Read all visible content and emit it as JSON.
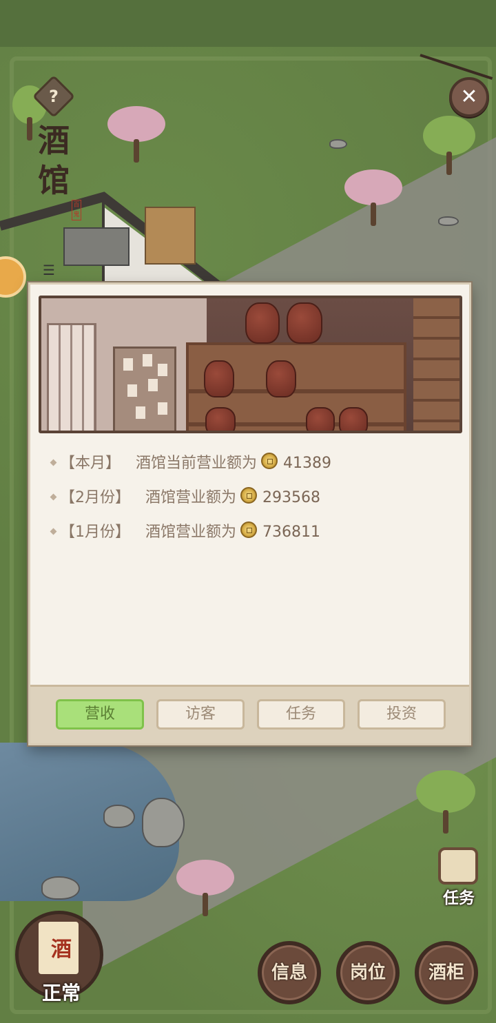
{
  "header": {
    "help_label": "?",
    "title": "酒馆",
    "title_stamp": "百鬼",
    "close_label": "✕"
  },
  "panel": {
    "revenue": [
      {
        "period": "【本月】",
        "description": "酒馆当前营业额为",
        "amount": "41389"
      },
      {
        "period": "【2月份】",
        "description": "酒馆营业额为",
        "amount": "293568"
      },
      {
        "period": "【1月份】",
        "description": "酒馆营业额为",
        "amount": "736811"
      }
    ],
    "tabs": [
      {
        "label": "营收",
        "active": true
      },
      {
        "label": "访客",
        "active": false
      },
      {
        "label": "任务",
        "active": false
      },
      {
        "label": "投资",
        "active": false
      }
    ]
  },
  "hud": {
    "tavern_sign": "酒",
    "tavern_status": "正常",
    "task_label": "任务",
    "buttons": [
      {
        "label": "信息"
      },
      {
        "label": "岗位"
      },
      {
        "label": "酒柜"
      }
    ]
  },
  "colors": {
    "active_tab": "#a9e07a",
    "grass": "#627f44",
    "panel_bg": "#f6f2ea",
    "coin": "#d9b04a"
  },
  "icons": {
    "help": "question-mark-icon",
    "close": "close-icon",
    "coin": "copper-coin-icon",
    "task": "scroll-icon"
  }
}
